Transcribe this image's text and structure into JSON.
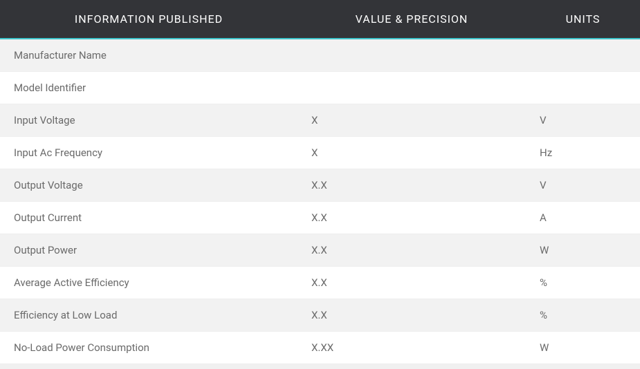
{
  "headers": {
    "info": "INFORMATION PUBLISHED",
    "value": "VALUE & PRECISION",
    "units": "UNITS"
  },
  "rows": [
    {
      "info": "Manufacturer Name",
      "value": "",
      "units": ""
    },
    {
      "info": "Model Identifier",
      "value": "",
      "units": ""
    },
    {
      "info": "Input Voltage",
      "value": "X",
      "units": "V"
    },
    {
      "info": "Input Ac Frequency",
      "value": "X",
      "units": "Hz"
    },
    {
      "info": "Output Voltage",
      "value": "X.X",
      "units": "V"
    },
    {
      "info": "Output Current",
      "value": "X.X",
      "units": "A"
    },
    {
      "info": "Output Power",
      "value": "X.X",
      "units": "W"
    },
    {
      "info": "Average Active Efficiency",
      "value": "X.X",
      "units": "%"
    },
    {
      "info": "Efficiency at Low Load",
      "value": "X.X",
      "units": "%"
    },
    {
      "info": "No-Load Power Consumption",
      "value": "X.XX",
      "units": "W"
    }
  ]
}
